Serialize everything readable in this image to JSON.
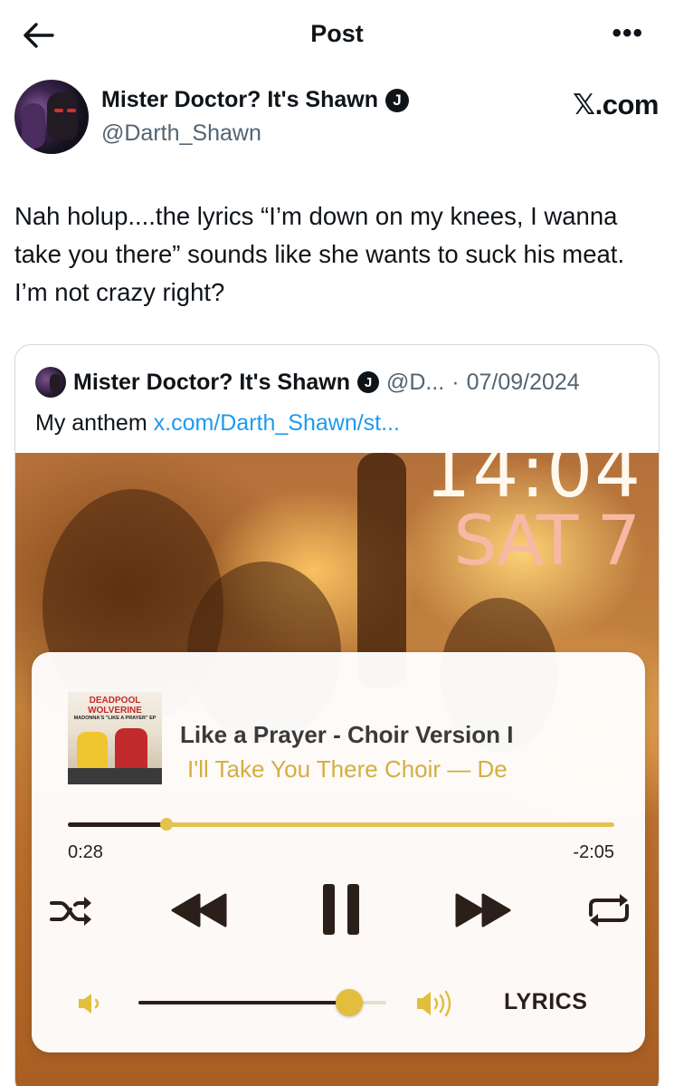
{
  "header": {
    "title": "Post",
    "more_label": "•••"
  },
  "author": {
    "name": "Mister Doctor? It's Shawn",
    "badge": "J",
    "handle": "@Darth_Shawn",
    "source": "𝕏.com"
  },
  "tweet": {
    "text": "Nah holup....the lyrics “I’m down on my knees, I wanna take you there” sounds like she wants to suck his meat. I’m not crazy right?"
  },
  "quote": {
    "name": "Mister Doctor? It's Shawn",
    "badge": "J",
    "handle": "@D...",
    "dot": "·",
    "date": "07/09/2024",
    "text": "My anthem",
    "link": "x.com/Darth_Shawn/st..."
  },
  "lockscreen": {
    "time": "14:04",
    "date": "SAT 7"
  },
  "player": {
    "art_title": "DEADPOOL\nWOLVERINE",
    "art_subtitle": "MADONNA'S \"LIKE A PRAYER\" EP",
    "track_title": "Like a Prayer - Choir Version I",
    "track_subtitle": "I'll Take You There Choir — De",
    "elapsed": "0:28",
    "remaining": "-2:05",
    "progress_fraction": 0.18,
    "volume_fraction": 0.85,
    "lyrics_label": "LYRICS",
    "accent_color": "#e3c24f",
    "dark_color": "#2b1f1a"
  },
  "icons": {
    "back": "arrow-left-icon",
    "shuffle": "shuffle-icon",
    "previous": "rewind-icon",
    "pause": "pause-icon",
    "next": "fast-forward-icon",
    "repeat": "repeat-icon",
    "volume_low": "speaker-low-icon",
    "volume_high": "speaker-high-icon"
  }
}
